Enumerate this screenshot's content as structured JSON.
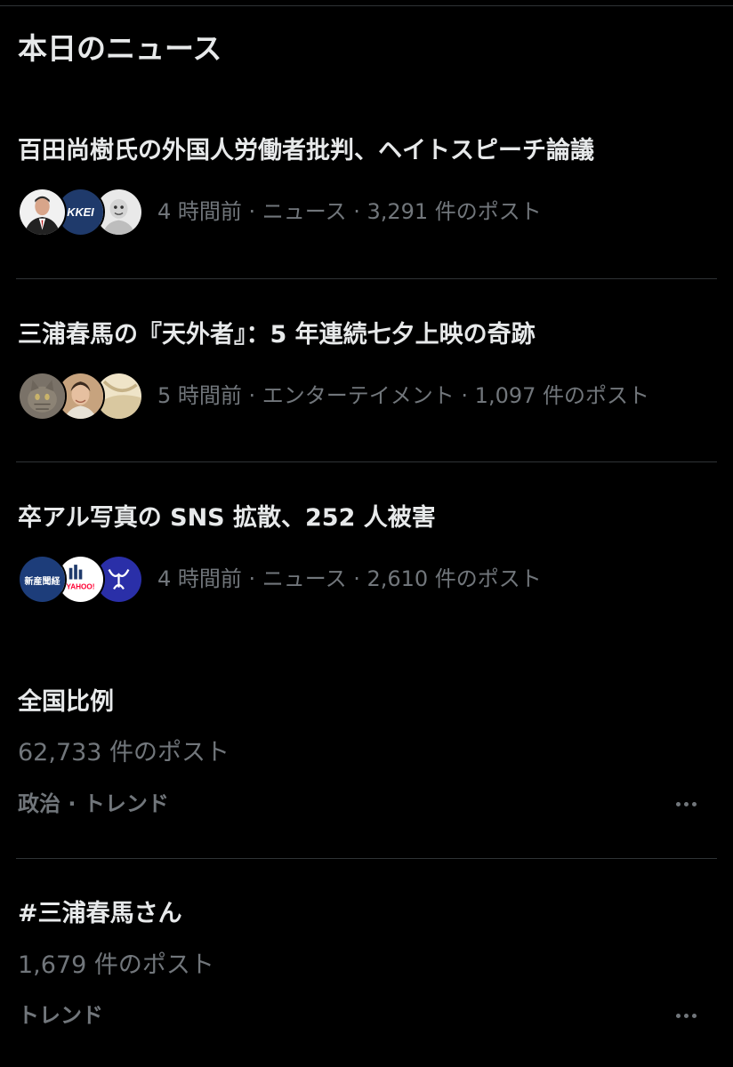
{
  "section": {
    "title": "本日のニュース"
  },
  "news": [
    {
      "headline": "百田尚樹氏の外国人労働者批判、ヘイトスピーチ論議",
      "meta": "4 時間前 · ニュース · 3,291 件のポスト",
      "avatars": [
        "person-avatar",
        "nikkei-logo-avatar",
        "cartoon-avatar"
      ]
    },
    {
      "headline": "三浦春馬の『天外者』：5 年連続七夕上映の奇跡",
      "meta": "5 時間前 · エンターテイメント · 1,097 件のポスト",
      "avatars": [
        "cat-avatar",
        "person-avatar",
        "abstract-avatar"
      ]
    },
    {
      "headline": "卒アル写真の SNS 拡散、252 人被害",
      "meta": "4 時間前 · ニュース · 2,610 件のポスト",
      "avatars": [
        "sankei-logo-avatar",
        "yahoo-logo-avatar",
        "emblem-avatar"
      ],
      "avatar_text": {
        "sankei": "新産聞経",
        "yahoo": "YAHOO!"
      }
    }
  ],
  "trends": [
    {
      "title": "全国比例",
      "count": "62,733 件のポスト",
      "category": "政治 · トレンド"
    },
    {
      "title": "#三浦春馬さん",
      "count": "1,679 件のポスト",
      "category": "トレンド"
    }
  ],
  "more_icon": "ellipsis-icon",
  "colors": {
    "background": "#000000",
    "primary_text": "#e7e9ea",
    "secondary_text": "#71767b",
    "divider": "#2f3336"
  }
}
